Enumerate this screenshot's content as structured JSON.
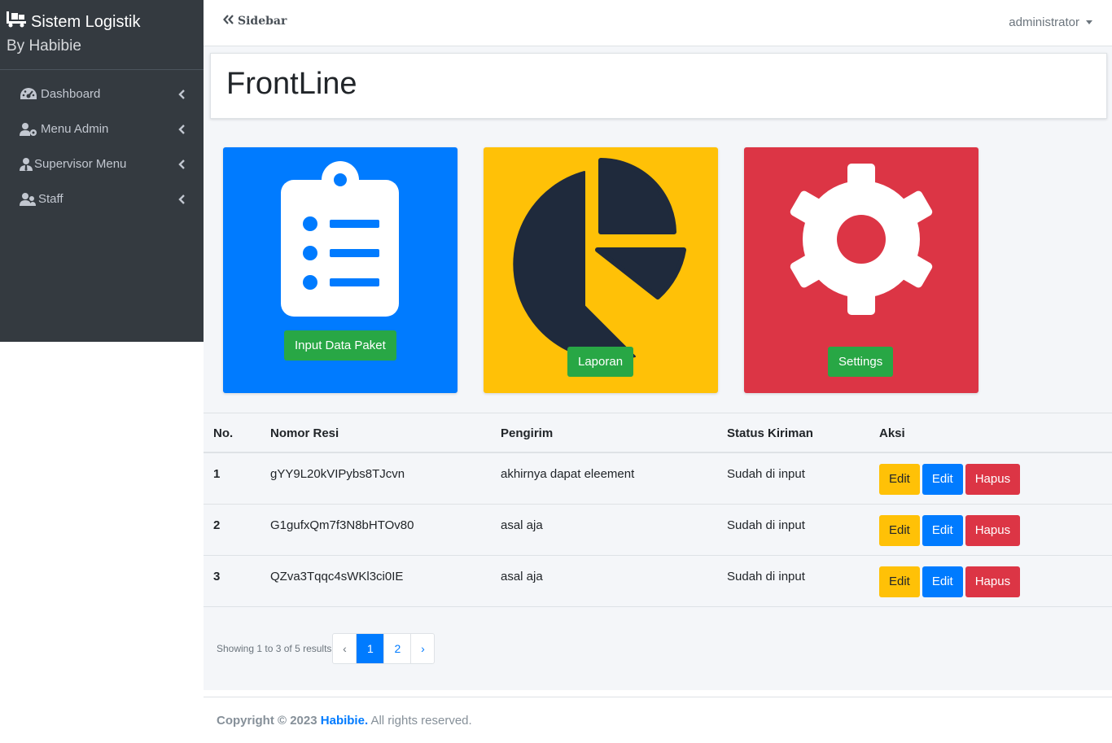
{
  "brand": {
    "title": "Sistem Logistik",
    "subtitle": "By Habibie"
  },
  "sidebar": {
    "items": [
      {
        "label": "Dashboard",
        "icon": "tachometer-icon"
      },
      {
        "label": "Menu Admin",
        "icon": "user-cog-icon"
      },
      {
        "label": "Supervisor Menu",
        "icon": "user-tie-icon"
      },
      {
        "label": "Staff",
        "icon": "users-icon"
      }
    ]
  },
  "topbar": {
    "toggle_label": "Sidebar",
    "user_label": "administrator"
  },
  "page": {
    "title": "FrontLine"
  },
  "tiles": [
    {
      "button": "Input Data Paket",
      "icon": "clipboard-list-icon",
      "color": "#007bff"
    },
    {
      "button": "Laporan",
      "icon": "chart-pie-icon",
      "color": "#ffc107"
    },
    {
      "button": "Settings",
      "icon": "cog-icon",
      "color": "#dc3545"
    }
  ],
  "table": {
    "headers": [
      "No.",
      "Nomor Resi",
      "Pengirim",
      "Status Kiriman",
      "Aksi"
    ],
    "rows": [
      {
        "no": "1",
        "resi": "gYY9L20kVIPybs8TJcvn",
        "pengirim": "akhirnya dapat eleement",
        "status": "Sudah di input"
      },
      {
        "no": "2",
        "resi": "G1gufxQm7f3N8bHTOv80",
        "pengirim": "asal aja",
        "status": "Sudah di input"
      },
      {
        "no": "3",
        "resi": "QZva3Tqqc4sWKl3ci0IE",
        "pengirim": "asal aja",
        "status": "Sudah di input"
      }
    ],
    "actions": {
      "edit1": "Edit",
      "edit2": "Edit",
      "delete": "Hapus"
    }
  },
  "pagination": {
    "info": "Showing 1 to 3 of 5 results",
    "prev": "‹",
    "pages": [
      "1",
      "2"
    ],
    "next": "›",
    "current": "1"
  },
  "footer": {
    "copyright": "Copyright © 2023",
    "author": "Habibie.",
    "rights": "All rights reserved."
  }
}
